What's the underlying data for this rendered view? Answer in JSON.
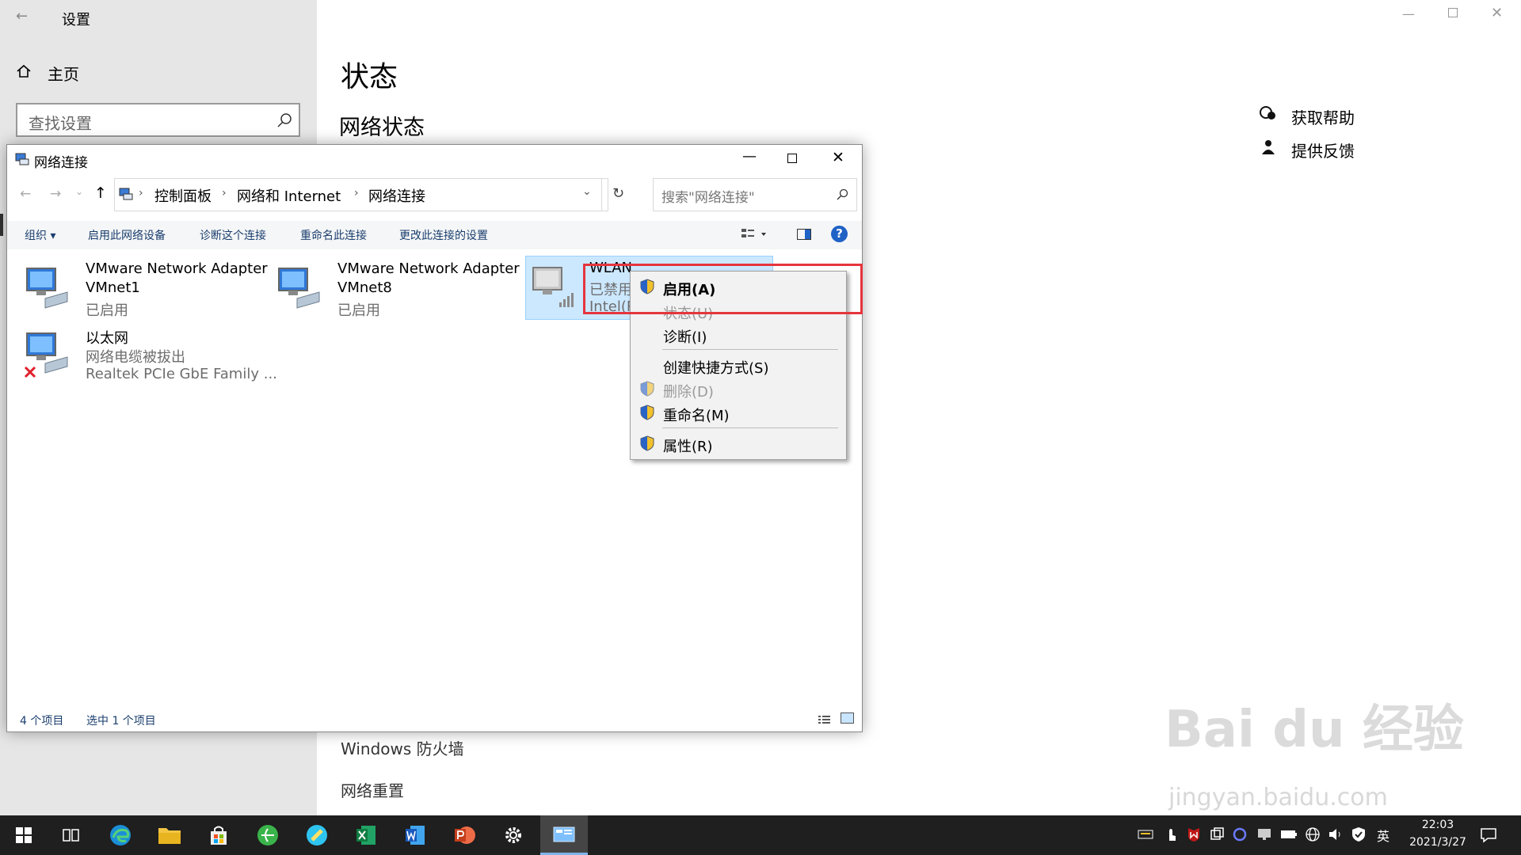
{
  "settings": {
    "title": "设置",
    "home_label": "主页",
    "search_placeholder": "查找设置",
    "page_title": "状态",
    "section_title": "网络状态",
    "help_label": "获取帮助",
    "feedback_label": "提供反馈",
    "firewall_label": "Windows 防火墙",
    "reset_label": "网络重置"
  },
  "netwin": {
    "title": "网络连接",
    "breadcrumb": [
      "控制面板",
      "网络和 Internet",
      "网络连接"
    ],
    "search_placeholder": "搜索\"网络连接\"",
    "toolbar": {
      "organize": "组织",
      "enable_device": "启用此网络设备",
      "diagnose": "诊断这个连接",
      "rename": "重命名此连接",
      "change_settings": "更改此连接的设置"
    },
    "adapters": [
      {
        "name": "VMware Network Adapter",
        "name2": "VMnet1",
        "status": "已启用"
      },
      {
        "name": "VMware Network Adapter",
        "name2": "VMnet8",
        "status": "已启用"
      },
      {
        "name": "WLAN",
        "status": "已禁用",
        "device": "Intel(R)"
      },
      {
        "name": "以太网",
        "status": "网络电缆被拔出",
        "device": "Realtek PCIe GbE Family ..."
      }
    ],
    "status_count": "4 个项目",
    "status_selected": "选中 1 个项目"
  },
  "context_menu": {
    "items": [
      {
        "label": "启用(A)",
        "shield": true,
        "bold": true,
        "disabled": false
      },
      {
        "label": "状态(U)",
        "shield": false,
        "bold": false,
        "disabled": true
      },
      {
        "label": "诊断(I)",
        "shield": false,
        "bold": false,
        "disabled": false
      },
      {
        "label": "创建快捷方式(S)",
        "shield": false,
        "bold": false,
        "disabled": false
      },
      {
        "label": "删除(D)",
        "shield": true,
        "bold": false,
        "disabled": true
      },
      {
        "label": "重命名(M)",
        "shield": true,
        "bold": false,
        "disabled": false
      },
      {
        "label": "属性(R)",
        "shield": true,
        "bold": false,
        "disabled": false
      }
    ]
  },
  "taskbar": {
    "time": "22:03",
    "date": "2021/3/27",
    "ime": "英"
  },
  "watermark": {
    "brand": "Bai du 经验",
    "url": "jingyan.baidu.com"
  },
  "colors": {
    "highlight_red": "#e5353d",
    "selection_blue": "#cce8ff",
    "help_blue": "#1f62c6"
  }
}
